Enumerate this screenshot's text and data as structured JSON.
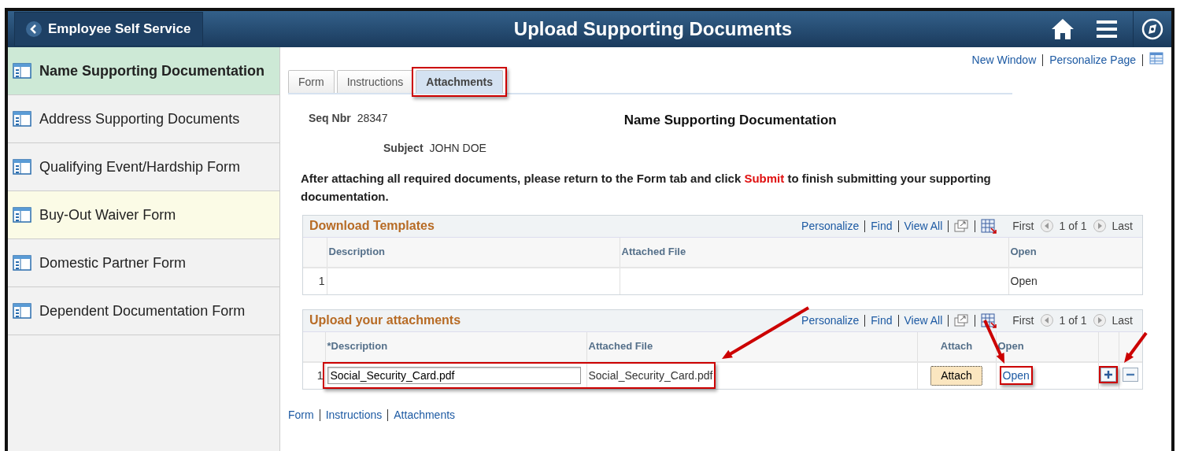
{
  "header": {
    "back_label": "Employee Self Service",
    "title": "Upload Supporting Documents"
  },
  "sidebar": {
    "items": [
      {
        "label": "Name Supporting Documentation",
        "selected": true,
        "hovered": false
      },
      {
        "label": "Address Supporting Documents",
        "selected": false,
        "hovered": false
      },
      {
        "label": "Qualifying Event/Hardship Form",
        "selected": false,
        "hovered": false
      },
      {
        "label": "Buy-Out Waiver Form",
        "selected": false,
        "hovered": true
      },
      {
        "label": "Domestic Partner Form",
        "selected": false,
        "hovered": false
      },
      {
        "label": "Dependent Documentation Form",
        "selected": false,
        "hovered": false
      }
    ]
  },
  "page_links": [
    "New Window",
    "Personalize Page"
  ],
  "tabs": [
    {
      "label": "Form",
      "selected": false,
      "outlined": false
    },
    {
      "label": "Instructions",
      "selected": false,
      "outlined": false
    },
    {
      "label": "Attachments",
      "selected": true,
      "outlined": true
    }
  ],
  "record": {
    "seq_label": "Seq Nbr",
    "seq_value": "28347",
    "title": "Name Supporting Documentation",
    "subject_label": "Subject",
    "subject_value": "JOHN DOE"
  },
  "instructions": {
    "before": "After attaching all required documents, please return to the Form tab and click ",
    "highlight": "Submit",
    "after": " to finish submitting your supporting documentation."
  },
  "grids": [
    {
      "title": "Download Templates",
      "tools": [
        "Personalize",
        "Find",
        "View All"
      ],
      "nav": {
        "first": "First",
        "count": "1 of 1",
        "last": "Last"
      },
      "columns": [
        "Description",
        "Attached File",
        "Open"
      ],
      "rows": [
        {
          "row_number": "1",
          "kind": "template",
          "open_label": "Open"
        }
      ]
    },
    {
      "title": "Upload your attachments",
      "tools": [
        "Personalize",
        "Find",
        "View All"
      ],
      "nav": {
        "first": "First",
        "count": "1 of 1",
        "last": "Last"
      },
      "columns": [
        "*Description",
        "Attached File",
        "Attach",
        "Open"
      ],
      "rows": [
        {
          "row_number": "1",
          "kind": "upload",
          "description": "Social_Security_Card.pdf",
          "attached_file": "Social_Security_Card.pdf",
          "attach_label": "Attach",
          "open_label": "Open",
          "outlined": true,
          "arrow": true,
          "open_outlined": true,
          "open_arrow": true,
          "add_outlined": true,
          "add_arrow": true
        }
      ]
    }
  ],
  "bottom_links": [
    "Form",
    "Instructions",
    "Attachments"
  ]
}
